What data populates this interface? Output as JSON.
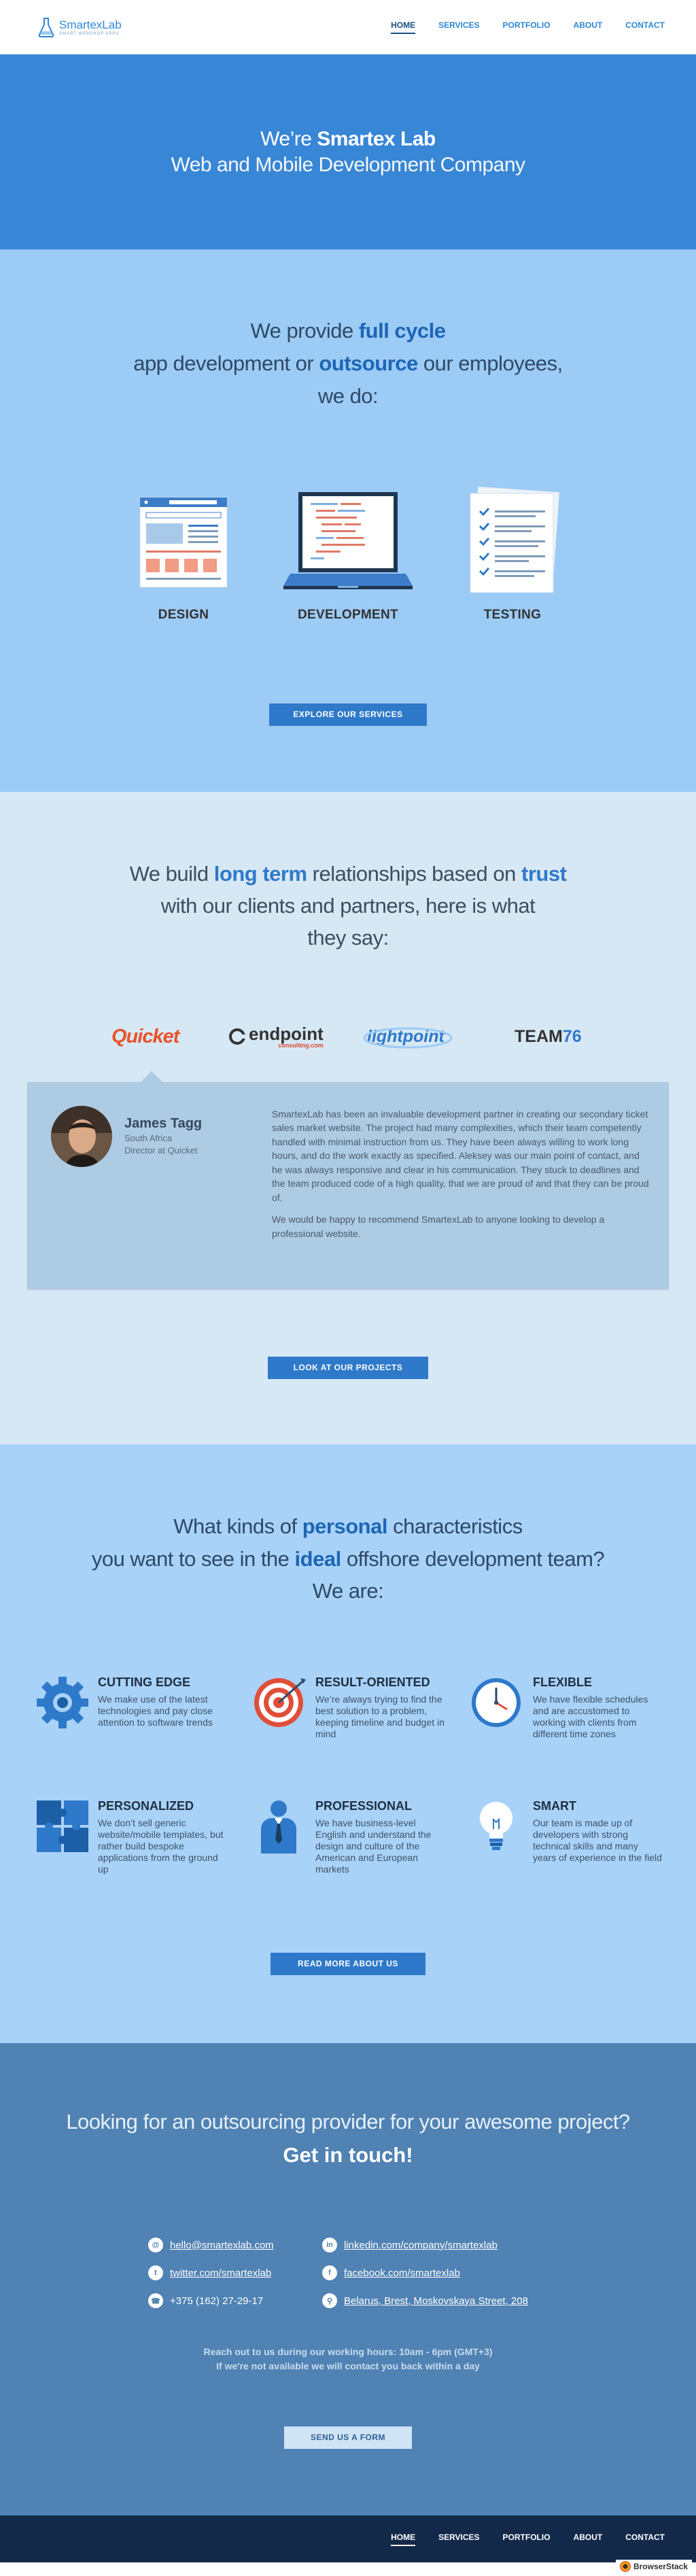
{
  "header": {
    "logo_name": "SmartexLab",
    "logo_tagline": "SMART WEBSHOP APPS",
    "nav": [
      "HOME",
      "SERVICES",
      "PORTFOLIO",
      "ABOUT",
      "CONTACT"
    ],
    "active_nav": "HOME"
  },
  "hero": {
    "line1_prefix": "We’re",
    "line1_bold": "Smartex Lab",
    "line2": "Web and Mobile Development Company"
  },
  "provide": {
    "a": "We provide",
    "b": "full cycle",
    "c": "app development or",
    "d": "outsource",
    "e": "our employees,",
    "f": "we do:",
    "services": [
      "DESIGN",
      "DEVELOPMENT",
      "TESTING"
    ],
    "button": "EXPLORE OUR SERVICES"
  },
  "trust": {
    "a": "We build",
    "b": "long term",
    "c": "relationships based on",
    "d": "trust",
    "e": "with our clients and partners, here is what",
    "f": "they say:",
    "clients": {
      "quicket": "Quicket",
      "endpoint": "endpoint",
      "endpoint_sub": "consulting.com",
      "lightpoint": "lightpoint",
      "team_a": "TEAM",
      "team_b": "76"
    },
    "testimonial": {
      "name": "James Tagg",
      "country": "South Africa",
      "role": "Director at Quicket",
      "p1": "SmartexLab has been an invaluable development partner in creating our secondary ticket sales market website. The project had many complexities, which their team competently handled with minimal instruction from us. They have been always willing to work long hours, and do the work exactly as specified. Aleksey was our main point of contact, and he was always responsive and clear in his communication. They stuck to deadlines and the team produced code of a high quality, that we are proud of and that they can be proud of.",
      "p2": "We would be happy to recommend SmartexLab to anyone looking to develop a professional website."
    },
    "button": "LOOK AT OUR PROJECTS"
  },
  "characteristics": {
    "a": "What kinds of",
    "b": "personal",
    "c": "characteristics",
    "d": "you want to see in the",
    "e": "ideal",
    "f": "offshore development team?",
    "g": "We are:",
    "items": [
      {
        "title": "CUTTING EDGE",
        "text": "We make use of the latest technologies and pay close attention to software trends",
        "icon": "gear-icon"
      },
      {
        "title": "RESULT-ORIENTED",
        "text": "We’re always trying to find the best solution to a problem, keeping timeline and budget in mind",
        "icon": "target-icon"
      },
      {
        "title": "FLEXIBLE",
        "text": "We have flexible schedules and are accustomed to working with clients from different time zones",
        "icon": "clock-icon"
      },
      {
        "title": "PERSONALIZED",
        "text": "We don’t sell generic website/mobile templates, but rather build bespoke applications from the ground up",
        "icon": "puzzle-icon"
      },
      {
        "title": "PROFESSIONAL",
        "text": "We have business-level English and understand the design and culture of the American and European markets",
        "icon": "businessman-icon"
      },
      {
        "title": "SMART",
        "text": "Our team is made up of developers with strong technical skills and many years of experience in the field",
        "icon": "lightbulb-icon"
      }
    ],
    "button": "READ MORE ABOUT US"
  },
  "contact": {
    "line1": "Looking for an outsourcing provider for your awesome project?",
    "line2": "Get in touch!",
    "email": "hello@smartexlab.com",
    "twitter": "twitter.com/smartexlab",
    "phone": "+375 (162) 27-29-17",
    "linkedin": "linkedin.com/company/smartexlab",
    "facebook": "facebook.com/smartexlab",
    "address": "Belarus, Brest, Moskovskaya Street, 208",
    "hours1": "Reach out to us during our working hours: 10am - 6pm (GMT+3)",
    "hours2": "If we're not available we will contact you back within a day",
    "button": "SEND US A FORM"
  },
  "footer": {
    "nav": [
      "HOME",
      "SERVICES",
      "PORTFOLIO",
      "ABOUT",
      "CONTACT"
    ],
    "active_nav": "HOME"
  },
  "browserstack": "BrowserStack",
  "colors": {
    "brand": "#2e79c9",
    "hero_bg": "#3886d6",
    "provide_bg": "#9ccbf6",
    "trust_bg": "#d7e8f5",
    "char_bg": "#a9d2f9",
    "contact_bg": "#5082b3",
    "footer_bg": "#13294a"
  }
}
